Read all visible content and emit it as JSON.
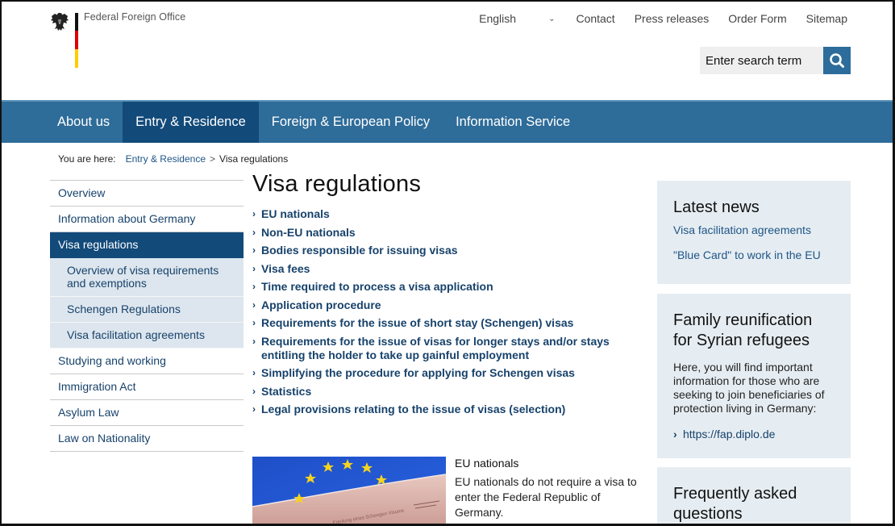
{
  "header": {
    "org_name": "Federal Foreign Office",
    "language": "English",
    "links": [
      "Contact",
      "Press releases",
      "Order Form",
      "Sitemap"
    ],
    "search": {
      "placeholder": "Enter search term"
    }
  },
  "main_nav": {
    "items": [
      {
        "label": "About us",
        "active": false
      },
      {
        "label": "Entry & Residence",
        "active": true
      },
      {
        "label": "Foreign & European Policy",
        "active": false
      },
      {
        "label": "Information Service",
        "active": false
      }
    ]
  },
  "breadcrumb": {
    "label": "You are here:",
    "items": [
      "Entry & Residence",
      "Visa regulations"
    ],
    "separator": ">"
  },
  "sidebar": {
    "items": [
      {
        "label": "Overview",
        "type": "normal"
      },
      {
        "label": "Information about Germany",
        "type": "normal"
      },
      {
        "label": "Visa regulations",
        "type": "active"
      },
      {
        "label": "Overview of visa requirements and exemptions",
        "type": "sub"
      },
      {
        "label": "Schengen Regulations",
        "type": "sub"
      },
      {
        "label": "Visa facilitation agreements",
        "type": "sub"
      },
      {
        "label": "Studying and working",
        "type": "normal"
      },
      {
        "label": "Immigration Act",
        "type": "normal"
      },
      {
        "label": "Asylum Law",
        "type": "normal"
      },
      {
        "label": "Law on Nationality",
        "type": "normal"
      }
    ]
  },
  "content": {
    "title": "Visa regulations",
    "links": [
      "EU nationals",
      "Non-EU nationals",
      "Bodies responsible for issuing visas",
      "Visa fees",
      "Time required to process a visa application",
      "Application procedure",
      "Requirements for the issue of short stay (Schengen) visas",
      "Requirements for the issue of visas for longer stays and/or stays entitling the holder to take up gainful employment",
      "Simplifying the procedure for applying for Schengen visas",
      "Statistics",
      "Legal provisions relating to the issue of visas (selection)"
    ],
    "teaser": {
      "title": "EU nationals",
      "text": "EU nationals do not require a visa to enter the Federal Republic of Germany.",
      "image_caption": "Erteilung eines Schengen Visums"
    }
  },
  "right": {
    "latest_news": {
      "title": "Latest news",
      "links": [
        "Visa facilitation agreements",
        "\"Blue Card\" to work in the EU"
      ]
    },
    "family": {
      "title": "Family reunification for Syrian refugees",
      "text": "Here, you will find important information for those who are seeking to join beneficiaries of protection living in Germany:",
      "link": "https://fap.diplo.de"
    },
    "faq": {
      "title": "Frequently asked questions"
    }
  },
  "colors": {
    "nav_bg": "#2e6c99",
    "nav_active": "#124a7a",
    "link": "#17426b",
    "box_bg": "#e6edf2",
    "sub_bg": "#dde6ee"
  }
}
